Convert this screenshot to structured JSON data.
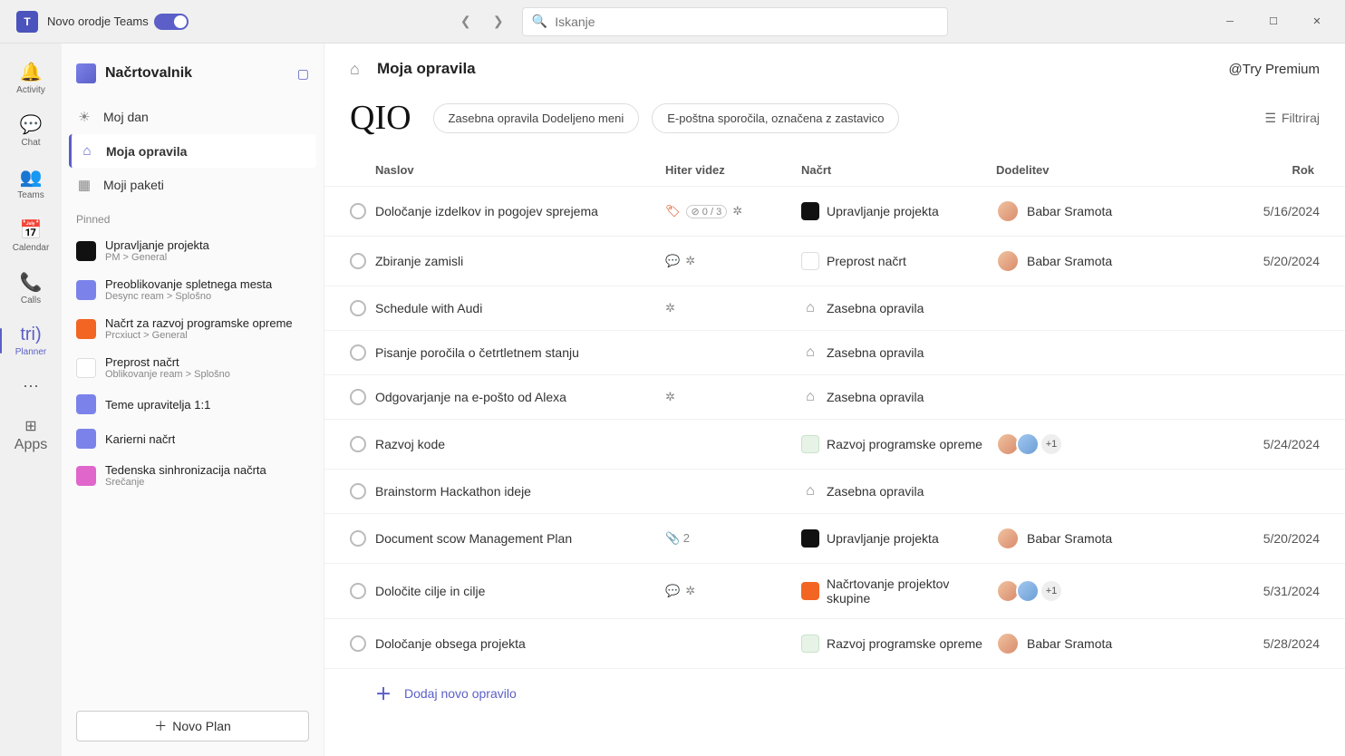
{
  "titlebar": {
    "toggle_label": "Novo orodje Teams",
    "search_placeholder": "Iskanje"
  },
  "rail": {
    "activity": "Activity",
    "chat": "Chat",
    "teams": "Teams",
    "calendar": "Calendar",
    "calls": "Calls",
    "planner": "Planner",
    "planner_short": "tri)",
    "apps": "Apps"
  },
  "sidebar": {
    "title": "Načrtovalnik",
    "myday": "Moj dan",
    "mytasks": "Moja opravila",
    "myplans": "Moji paketi",
    "pinned_label": "Pinned",
    "pins": [
      {
        "title": "Upravljanje projekta",
        "sub": "PM > General",
        "color": "#111"
      },
      {
        "title": "Preoblikovanje spletnega mesta",
        "sub": "Desync ream > Splošno",
        "color": "#7b83eb"
      },
      {
        "title": "Načrt za razvoj programske opreme",
        "sub": "Prcxiuct > General",
        "color": "#f26522"
      },
      {
        "title": "Preprost načrt",
        "sub": "Oblikovanje ream > Splošno",
        "color": "#ffffff"
      },
      {
        "title": "Teme upravitelja 1:1",
        "sub": "",
        "color": "#7b83eb"
      },
      {
        "title": "Karierni načrt",
        "sub": "",
        "color": "#7b83eb"
      },
      {
        "title": "Tedenska sinhronizacija načrta",
        "sub": "Srečanje",
        "color": "#e066cc"
      }
    ],
    "new_plan": "Novo Plan"
  },
  "main": {
    "header_title": "Moja opravila",
    "premium": "@Try Premium",
    "qio": "QIO",
    "pill1": "Zasebna opravila Dodeljeno meni",
    "pill2": "E-poštna sporočila, označena z zastavico",
    "filter": "Filtriraj",
    "columns": {
      "title": "Naslov",
      "quick": "Hiter videz",
      "plan": "Načrt",
      "assign": "Dodelitev",
      "due": "Rok"
    },
    "tasks": [
      {
        "title": "Določanje izdelkov in pogojev sprejema",
        "quick": {
          "tag": true,
          "progress": "0 / 3",
          "light": true
        },
        "plan": "Upravljanje projekta",
        "planColor": "pi-black",
        "assign": {
          "name": "Babar Sramota",
          "avatars": 1
        },
        "due": "5/16/2024"
      },
      {
        "title": "Zbiranje zamisli",
        "quick": {
          "chat": true,
          "light": true
        },
        "plan": "Preprost načrt",
        "planColor": "pi-white",
        "assign": {
          "name": "Babar Sramota",
          "avatars": 1
        },
        "due": "5/20/2024"
      },
      {
        "title": "Schedule with Audi",
        "quick": {
          "light": true
        },
        "plan": "Zasebna opravila",
        "planColor": "pi-home",
        "assign": null,
        "due": ""
      },
      {
        "title": "Pisanje poročila o četrtletnem stanju",
        "quick": {},
        "plan": "Zasebna opravila",
        "planColor": "pi-home",
        "assign": null,
        "due": ""
      },
      {
        "title": "Odgovarjanje na e-pošto od Alexa",
        "quick": {
          "light": true
        },
        "plan": "Zasebna opravila",
        "planColor": "pi-home",
        "assign": null,
        "due": ""
      },
      {
        "title": "Razvoj kode",
        "quick": {},
        "plan": "Razvoj programske opreme",
        "planColor": "pi-green",
        "assign": {
          "name": "",
          "avatars": 2,
          "more": "+1"
        },
        "due": "5/24/2024"
      },
      {
        "title": "Brainstorm Hackathon ideje",
        "quick": {},
        "plan": "Zasebna opravila",
        "planColor": "pi-home",
        "assign": null,
        "due": ""
      },
      {
        "title": "Document scow Management Plan",
        "quick": {
          "attach": "2"
        },
        "plan": "Upravljanje projekta",
        "planColor": "pi-black",
        "assign": {
          "name": "Babar Sramota",
          "avatars": 1
        },
        "due": "5/20/2024"
      },
      {
        "title": "Določite cilje in cilje",
        "quick": {
          "chat": true,
          "light": true
        },
        "plan": "Načrtovanje projektov skupine",
        "planColor": "pi-orange",
        "assign": {
          "name": "",
          "avatars": 2,
          "more": "+1"
        },
        "due": "5/31/2024"
      },
      {
        "title": "Določanje obsega projekta",
        "quick": {},
        "plan": "Razvoj programske opreme",
        "planColor": "pi-green",
        "assign": {
          "name": "Babar Sramota",
          "avatars": 1
        },
        "due": "5/28/2024"
      }
    ],
    "add_task": "Dodaj novo opravilo"
  }
}
